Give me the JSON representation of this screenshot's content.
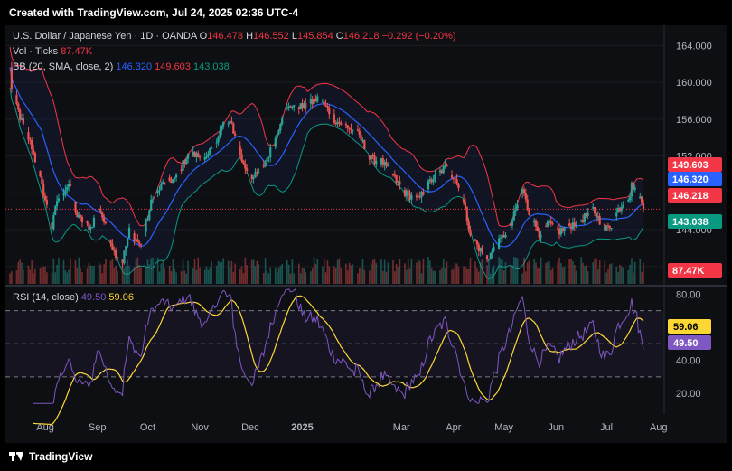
{
  "caption": "Created with TradingView.com, Jul 24, 2025 02:36 UTC-4",
  "footer_brand": "TradingView",
  "legend": {
    "symbol": "U.S. Dollar / Japanese Yen · 1D · OANDA",
    "o_label": "O",
    "o_value": "146.478",
    "h_label": "H",
    "h_value": "146.552",
    "l_label": "L",
    "l_value": "145.854",
    "c_label": "C",
    "c_value": "146.218",
    "change": "−0.292 (−0.20%)",
    "vol_label": "Vol · Ticks",
    "vol_value": "87.47K",
    "bb_label": "BB (20, SMA, close, 2)",
    "bb_basis": "146.320",
    "bb_upper": "149.603",
    "bb_lower": "143.038",
    "rsi_label": "RSI (14, close)",
    "rsi_value": "49.50",
    "rsi_ma_value": "59.06"
  },
  "colors": {
    "up": "#26a69a",
    "down": "#ef5350",
    "bb_basis": "#2962ff",
    "bb_upper": "#f23645",
    "bb_lower": "#089981",
    "rsi": "#7e57c2",
    "rsi_ma": "#fdd835"
  },
  "price_axis": {
    "ticks": [
      140,
      144,
      148,
      152,
      156,
      160,
      164
    ],
    "tick_labels": [
      "140.000",
      "144.000",
      "148.000",
      "152.000",
      "156.000",
      "160.000",
      "164.000"
    ],
    "badges": [
      {
        "label": "149.603",
        "value": 149.603,
        "color": "#f23645"
      },
      {
        "label": "146.320",
        "value": 146.32,
        "color": "#2962ff"
      },
      {
        "label": "146.218",
        "value": 146.218,
        "color": "#f23645"
      },
      {
        "label": "143.038",
        "value": 143.038,
        "color": "#089981"
      },
      {
        "label": "87.47K",
        "value": 87.47,
        "color": "#f23645"
      }
    ]
  },
  "rsi_axis": {
    "ticks": [
      20,
      40,
      80
    ],
    "tick_labels": [
      "20.00",
      "40.00",
      "80.00"
    ],
    "bands": [
      30,
      50,
      70
    ],
    "badges": [
      {
        "label": "59.06",
        "value": 59.06,
        "color": "#fdd835"
      },
      {
        "label": "49.50",
        "value": 49.5,
        "color": "#7e57c2"
      }
    ]
  },
  "time_axis": [
    "Aug",
    "Sep",
    "Oct",
    "Nov",
    "Dec",
    "2025",
    "Mar",
    "Apr",
    "May",
    "Jun",
    "Jul",
    "Aug"
  ],
  "chart_data": {
    "type": "candlestick",
    "title": "U.S. Dollar / Japanese Yen · 1D · OANDA",
    "ylim": [
      138.5,
      166.2
    ],
    "close_anchors": [
      {
        "date": "2024-07-11",
        "value": 161.5
      },
      {
        "date": "2024-07-12",
        "value": 159.5
      },
      {
        "date": "2024-07-17",
        "value": 156.2
      },
      {
        "date": "2024-07-24",
        "value": 153.0
      },
      {
        "date": "2024-07-31",
        "value": 148.0
      },
      {
        "date": "2024-08-05",
        "value": 144.2
      },
      {
        "date": "2024-08-08",
        "value": 147.2
      },
      {
        "date": "2024-08-15",
        "value": 149.0
      },
      {
        "date": "2024-08-20",
        "value": 145.4
      },
      {
        "date": "2024-08-28",
        "value": 144.2
      },
      {
        "date": "2024-09-02",
        "value": 146.5
      },
      {
        "date": "2024-09-11",
        "value": 141.6
      },
      {
        "date": "2024-09-16",
        "value": 140.6
      },
      {
        "date": "2024-09-20",
        "value": 143.9
      },
      {
        "date": "2024-09-27",
        "value": 142.2
      },
      {
        "date": "2024-10-03",
        "value": 146.9
      },
      {
        "date": "2024-10-10",
        "value": 149.0
      },
      {
        "date": "2024-10-18",
        "value": 149.6
      },
      {
        "date": "2024-10-25",
        "value": 152.3
      },
      {
        "date": "2024-10-31",
        "value": 152.0
      },
      {
        "date": "2024-11-05",
        "value": 151.6
      },
      {
        "date": "2024-11-15",
        "value": 155.5
      },
      {
        "date": "2024-11-20",
        "value": 155.4
      },
      {
        "date": "2024-11-27",
        "value": 151.0
      },
      {
        "date": "2024-12-03",
        "value": 149.6
      },
      {
        "date": "2024-12-09",
        "value": 151.0
      },
      {
        "date": "2024-12-16",
        "value": 153.8
      },
      {
        "date": "2024-12-20",
        "value": 156.5
      },
      {
        "date": "2024-12-26",
        "value": 157.6
      },
      {
        "date": "2025-01-02",
        "value": 157.3
      },
      {
        "date": "2025-01-10",
        "value": 158.2
      },
      {
        "date": "2025-01-14",
        "value": 157.5
      },
      {
        "date": "2025-01-21",
        "value": 155.8
      },
      {
        "date": "2025-01-27",
        "value": 155.3
      },
      {
        "date": "2025-02-04",
        "value": 154.2
      },
      {
        "date": "2025-02-10",
        "value": 151.7
      },
      {
        "date": "2025-02-17",
        "value": 151.4
      },
      {
        "date": "2025-02-24",
        "value": 149.8
      },
      {
        "date": "2025-03-03",
        "value": 148.0
      },
      {
        "date": "2025-03-11",
        "value": 147.2
      },
      {
        "date": "2025-03-18",
        "value": 149.2
      },
      {
        "date": "2025-03-27",
        "value": 150.8
      },
      {
        "date": "2025-04-02",
        "value": 149.6
      },
      {
        "date": "2025-04-07",
        "value": 146.9
      },
      {
        "date": "2025-04-11",
        "value": 143.6
      },
      {
        "date": "2025-04-16",
        "value": 142.0
      },
      {
        "date": "2025-04-21",
        "value": 140.9
      },
      {
        "date": "2025-04-28",
        "value": 142.6
      },
      {
        "date": "2025-05-05",
        "value": 144.5
      },
      {
        "date": "2025-05-12",
        "value": 148.4
      },
      {
        "date": "2025-05-16",
        "value": 145.8
      },
      {
        "date": "2025-05-22",
        "value": 143.6
      },
      {
        "date": "2025-05-28",
        "value": 144.6
      },
      {
        "date": "2025-06-03",
        "value": 143.8
      },
      {
        "date": "2025-06-11",
        "value": 144.6
      },
      {
        "date": "2025-06-17",
        "value": 145.2
      },
      {
        "date": "2025-06-23",
        "value": 146.2
      },
      {
        "date": "2025-06-30",
        "value": 144.0
      },
      {
        "date": "2025-07-04",
        "value": 144.5
      },
      {
        "date": "2025-07-08",
        "value": 146.2
      },
      {
        "date": "2025-07-15",
        "value": 147.8
      },
      {
        "date": "2025-07-16",
        "value": 148.8
      },
      {
        "date": "2025-07-18",
        "value": 148.6
      },
      {
        "date": "2025-07-21",
        "value": 147.4
      },
      {
        "date": "2025-07-23",
        "value": 146.2
      }
    ],
    "volume_ylim": [
      0,
      320
    ],
    "rsi_ylim": [
      13,
      84
    ]
  }
}
